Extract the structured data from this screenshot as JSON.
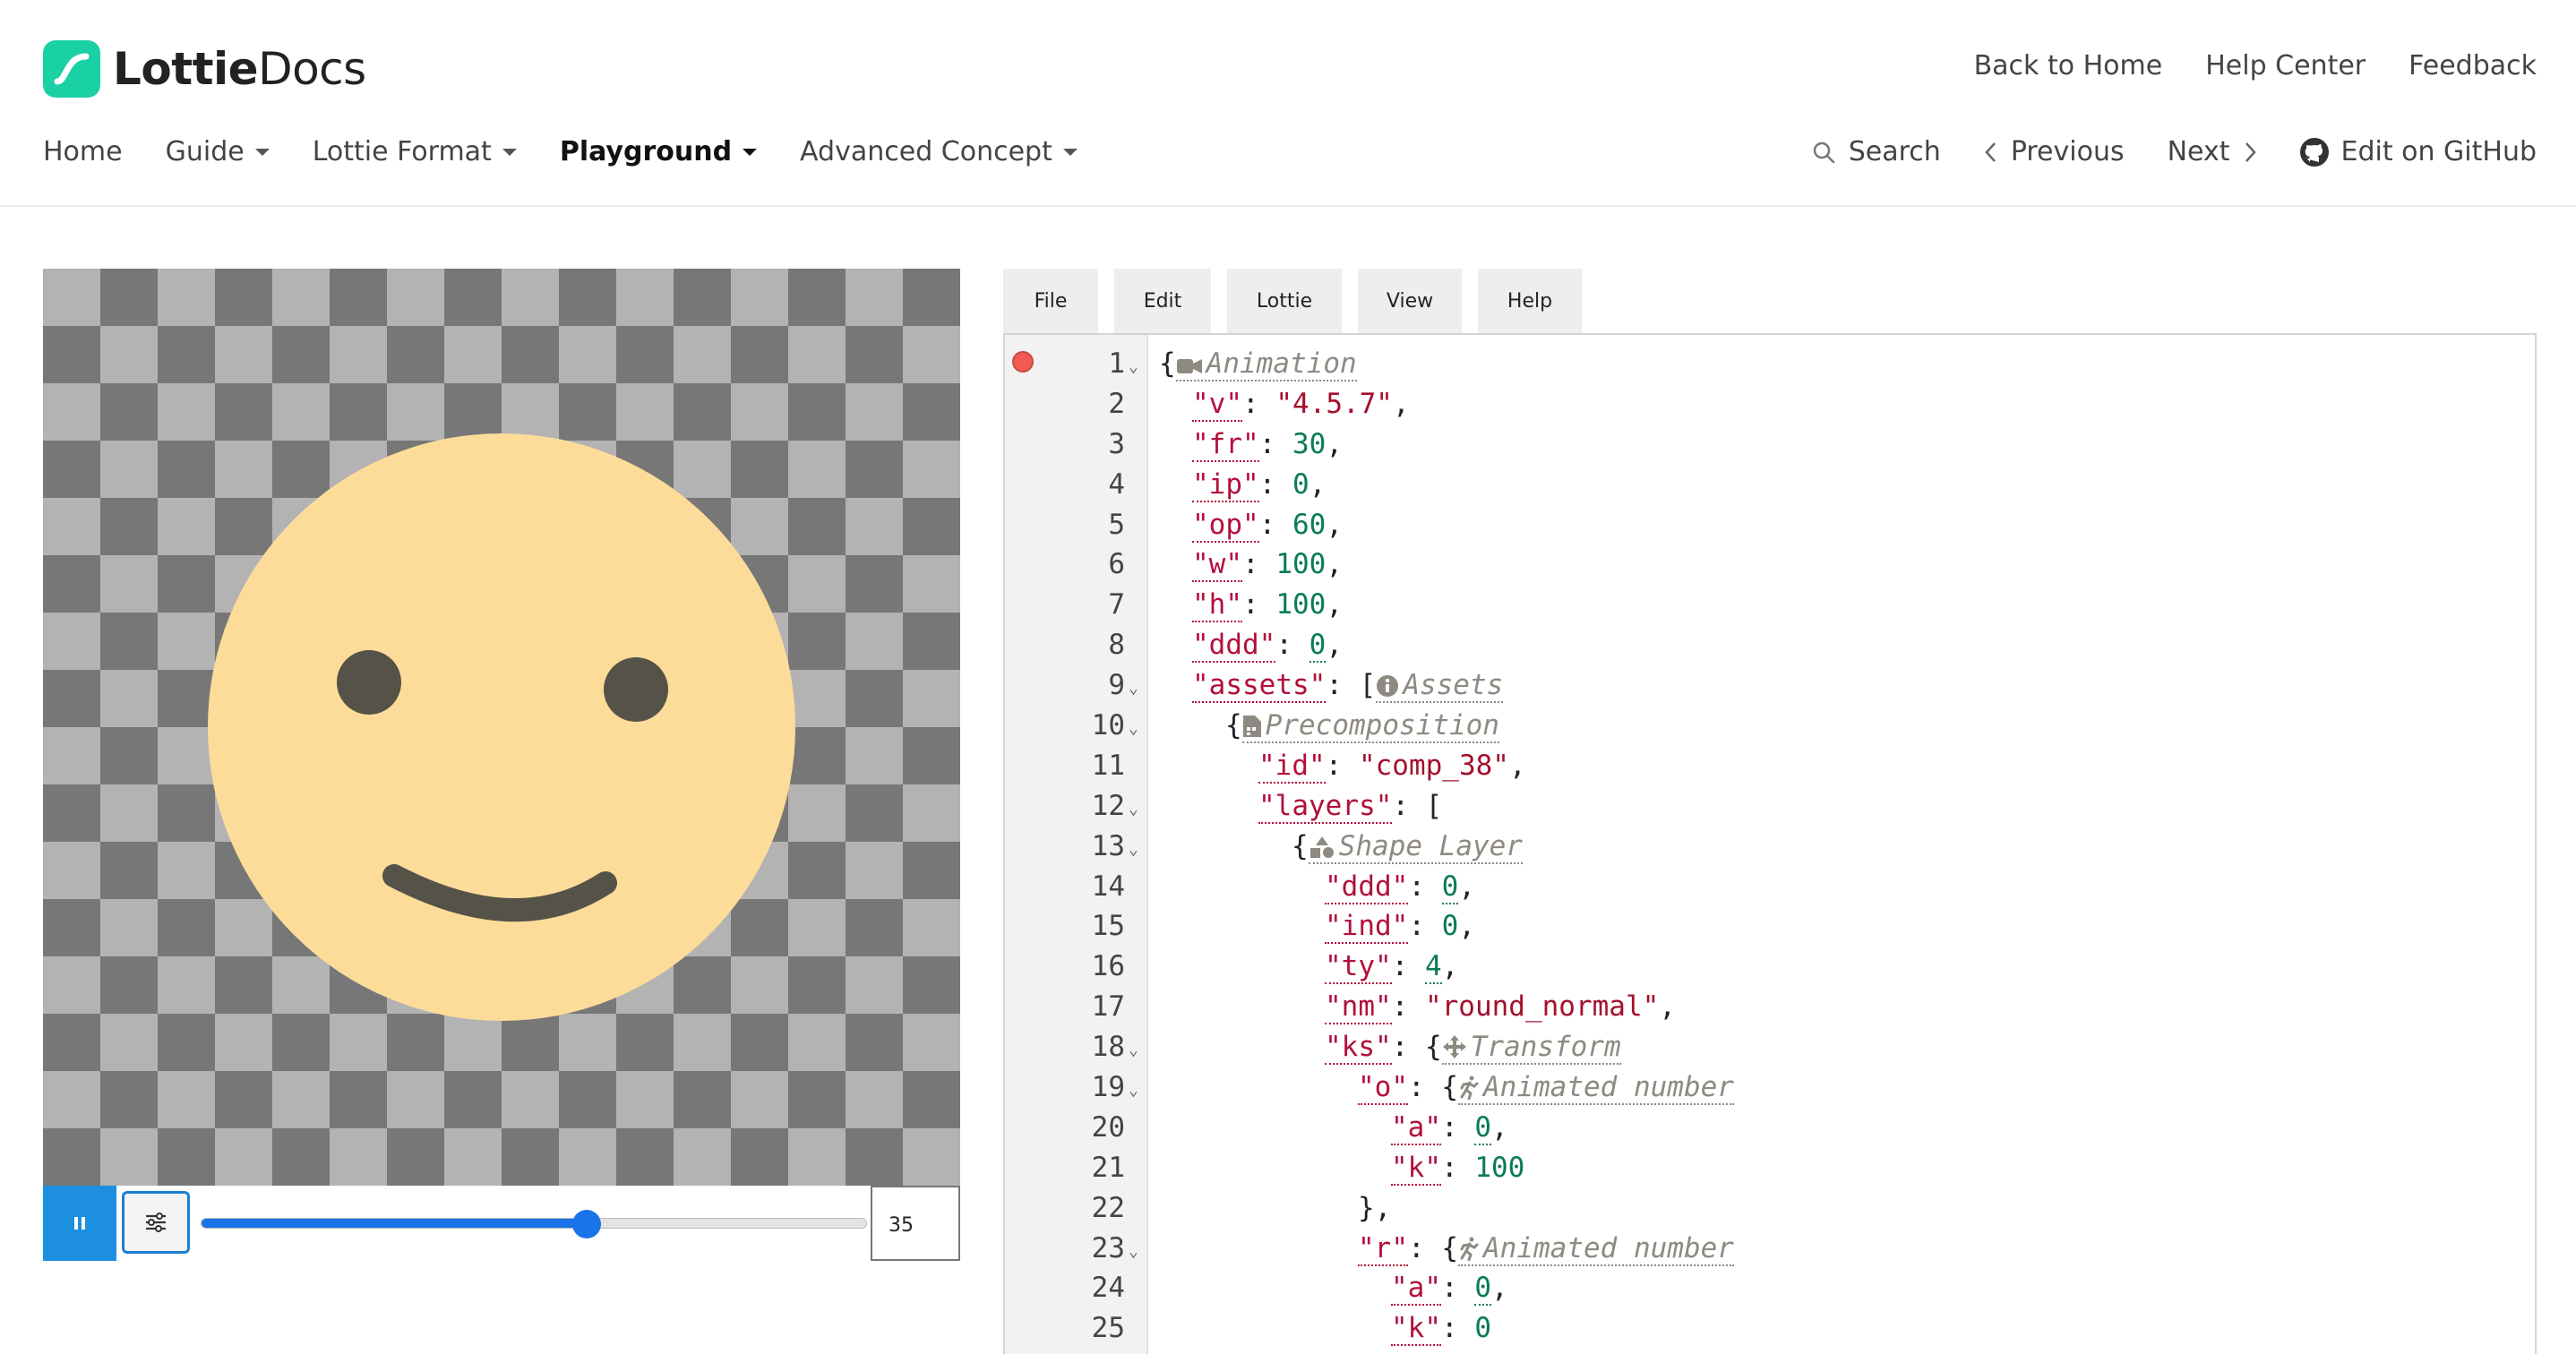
{
  "header": {
    "logo_bold": "Lottie",
    "logo_light": "Docs",
    "top_links": [
      "Back to Home",
      "Help Center",
      "Feedback"
    ],
    "nav": [
      {
        "label": "Home",
        "caret": false,
        "active": false
      },
      {
        "label": "Guide",
        "caret": true,
        "active": false
      },
      {
        "label": "Lottie Format",
        "caret": true,
        "active": false
      },
      {
        "label": "Playground",
        "caret": true,
        "active": true
      },
      {
        "label": "Advanced Concept",
        "caret": true,
        "active": false
      }
    ],
    "search_label": "Search",
    "previous_label": "Previous",
    "next_label": "Next",
    "github_label": "Edit on GitHub"
  },
  "player": {
    "frame_value": "35",
    "progress": 0.58,
    "colors": {
      "face": "#fddc9a",
      "features": "#555247",
      "accent": "#1c8fe0"
    }
  },
  "editor": {
    "menu": [
      "File",
      "Edit",
      "Lottie",
      "View",
      "Help"
    ],
    "lines": [
      {
        "n": "1",
        "fold": true,
        "indent": 0,
        "parts": [
          [
            "p",
            "{"
          ],
          [
            "h",
            "Animation",
            "camera"
          ]
        ]
      },
      {
        "n": "2",
        "fold": false,
        "indent": 1,
        "parts": [
          [
            "k",
            "\"v\""
          ],
          [
            "p",
            ": "
          ],
          [
            "s",
            "\"4.5.7\""
          ],
          [
            "p",
            ","
          ]
        ]
      },
      {
        "n": "3",
        "fold": false,
        "indent": 1,
        "parts": [
          [
            "k",
            "\"fr\""
          ],
          [
            "p",
            ": "
          ],
          [
            "n",
            "30"
          ],
          [
            "p",
            ","
          ]
        ]
      },
      {
        "n": "4",
        "fold": false,
        "indent": 1,
        "parts": [
          [
            "k",
            "\"ip\""
          ],
          [
            "p",
            ": "
          ],
          [
            "n",
            "0"
          ],
          [
            "p",
            ","
          ]
        ]
      },
      {
        "n": "5",
        "fold": false,
        "indent": 1,
        "parts": [
          [
            "k",
            "\"op\""
          ],
          [
            "p",
            ": "
          ],
          [
            "n",
            "60"
          ],
          [
            "p",
            ","
          ]
        ]
      },
      {
        "n": "6",
        "fold": false,
        "indent": 1,
        "parts": [
          [
            "k",
            "\"w\""
          ],
          [
            "p",
            ": "
          ],
          [
            "n",
            "100"
          ],
          [
            "p",
            ","
          ]
        ]
      },
      {
        "n": "7",
        "fold": false,
        "indent": 1,
        "parts": [
          [
            "k",
            "\"h\""
          ],
          [
            "p",
            ": "
          ],
          [
            "n",
            "100"
          ],
          [
            "p",
            ","
          ]
        ]
      },
      {
        "n": "8",
        "fold": false,
        "indent": 1,
        "parts": [
          [
            "k",
            "\"ddd\""
          ],
          [
            "p",
            ": "
          ],
          [
            "nu",
            "0"
          ],
          [
            "p",
            ","
          ]
        ]
      },
      {
        "n": "9",
        "fold": true,
        "indent": 1,
        "parts": [
          [
            "k",
            "\"assets\""
          ],
          [
            "p",
            ": ["
          ],
          [
            "h",
            "Assets",
            "info"
          ]
        ]
      },
      {
        "n": "10",
        "fold": true,
        "indent": 2,
        "parts": [
          [
            "p",
            "{"
          ],
          [
            "h",
            "Precomposition",
            "file"
          ]
        ]
      },
      {
        "n": "11",
        "fold": false,
        "indent": 3,
        "parts": [
          [
            "k",
            "\"id\""
          ],
          [
            "p",
            ": "
          ],
          [
            "s",
            "\"comp_38\""
          ],
          [
            "p",
            ","
          ]
        ]
      },
      {
        "n": "12",
        "fold": true,
        "indent": 3,
        "parts": [
          [
            "k",
            "\"layers\""
          ],
          [
            "p",
            ": ["
          ]
        ]
      },
      {
        "n": "13",
        "fold": true,
        "indent": 4,
        "parts": [
          [
            "p",
            "{"
          ],
          [
            "h",
            "Shape Layer",
            "shapes"
          ]
        ]
      },
      {
        "n": "14",
        "fold": false,
        "indent": 5,
        "parts": [
          [
            "k",
            "\"ddd\""
          ],
          [
            "p",
            ": "
          ],
          [
            "nu",
            "0"
          ],
          [
            "p",
            ","
          ]
        ]
      },
      {
        "n": "15",
        "fold": false,
        "indent": 5,
        "parts": [
          [
            "k",
            "\"ind\""
          ],
          [
            "p",
            ": "
          ],
          [
            "n",
            "0"
          ],
          [
            "p",
            ","
          ]
        ]
      },
      {
        "n": "16",
        "fold": false,
        "indent": 5,
        "parts": [
          [
            "k",
            "\"ty\""
          ],
          [
            "p",
            ": "
          ],
          [
            "nu",
            "4"
          ],
          [
            "p",
            ","
          ]
        ]
      },
      {
        "n": "17",
        "fold": false,
        "indent": 5,
        "parts": [
          [
            "k",
            "\"nm\""
          ],
          [
            "p",
            ": "
          ],
          [
            "s",
            "\"round_normal\""
          ],
          [
            "p",
            ","
          ]
        ]
      },
      {
        "n": "18",
        "fold": true,
        "indent": 5,
        "parts": [
          [
            "k",
            "\"ks\""
          ],
          [
            "p",
            ": {"
          ],
          [
            "h",
            "Transform",
            "move"
          ]
        ]
      },
      {
        "n": "19",
        "fold": true,
        "indent": 6,
        "parts": [
          [
            "k",
            "\"o\""
          ],
          [
            "p",
            ": {"
          ],
          [
            "h",
            "Animated number",
            "run"
          ]
        ]
      },
      {
        "n": "20",
        "fold": false,
        "indent": 7,
        "parts": [
          [
            "k",
            "\"a\""
          ],
          [
            "p",
            ": "
          ],
          [
            "nu",
            "0"
          ],
          [
            "p",
            ","
          ]
        ]
      },
      {
        "n": "21",
        "fold": false,
        "indent": 7,
        "parts": [
          [
            "k",
            "\"k\""
          ],
          [
            "p",
            ": "
          ],
          [
            "n",
            "100"
          ]
        ]
      },
      {
        "n": "22",
        "fold": false,
        "indent": 6,
        "parts": [
          [
            "p",
            "},"
          ]
        ]
      },
      {
        "n": "23",
        "fold": true,
        "indent": 6,
        "parts": [
          [
            "k",
            "\"r\""
          ],
          [
            "p",
            ": {"
          ],
          [
            "h",
            "Animated number",
            "run"
          ]
        ]
      },
      {
        "n": "24",
        "fold": false,
        "indent": 7,
        "parts": [
          [
            "k",
            "\"a\""
          ],
          [
            "p",
            ": "
          ],
          [
            "nu",
            "0"
          ],
          [
            "p",
            ","
          ]
        ]
      },
      {
        "n": "25",
        "fold": false,
        "indent": 7,
        "parts": [
          [
            "k",
            "\"k\""
          ],
          [
            "p",
            ": "
          ],
          [
            "n",
            "0"
          ]
        ]
      },
      {
        "n": "",
        "fold": false,
        "indent": 6,
        "parts": [
          [
            "p",
            "},"
          ]
        ]
      }
    ]
  }
}
